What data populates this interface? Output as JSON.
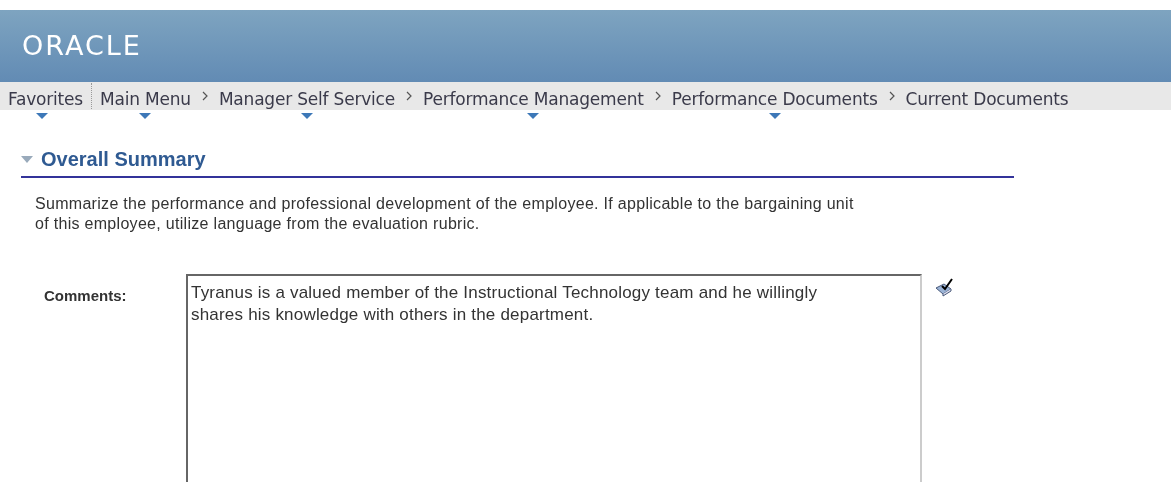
{
  "header": {
    "logo": "ORACLE"
  },
  "breadcrumbs": [
    {
      "label": "Favorites",
      "has_menu": true,
      "kind": "menu"
    },
    {
      "label": "Main Menu",
      "has_menu": true,
      "kind": "crumb"
    },
    {
      "label": "Manager Self Service",
      "has_menu": true,
      "kind": "crumb"
    },
    {
      "label": "Performance Management",
      "has_menu": true,
      "kind": "crumb"
    },
    {
      "label": "Performance Documents",
      "has_menu": true,
      "kind": "crumb"
    },
    {
      "label": "Current Documents",
      "has_menu": false,
      "kind": "crumb"
    }
  ],
  "section": {
    "title": "Overall Summary",
    "expanded": true,
    "instructions": "Summarize the performance and professional development of the employee. If applicable to the bargaining unit of this employee, utilize language from the evaluation rubric.",
    "comments_label": "Comments:",
    "comments_value": "Tyranus is a valued member of the Instructional Technology team and he willingly shares his knowledge with others in the department. "
  }
}
